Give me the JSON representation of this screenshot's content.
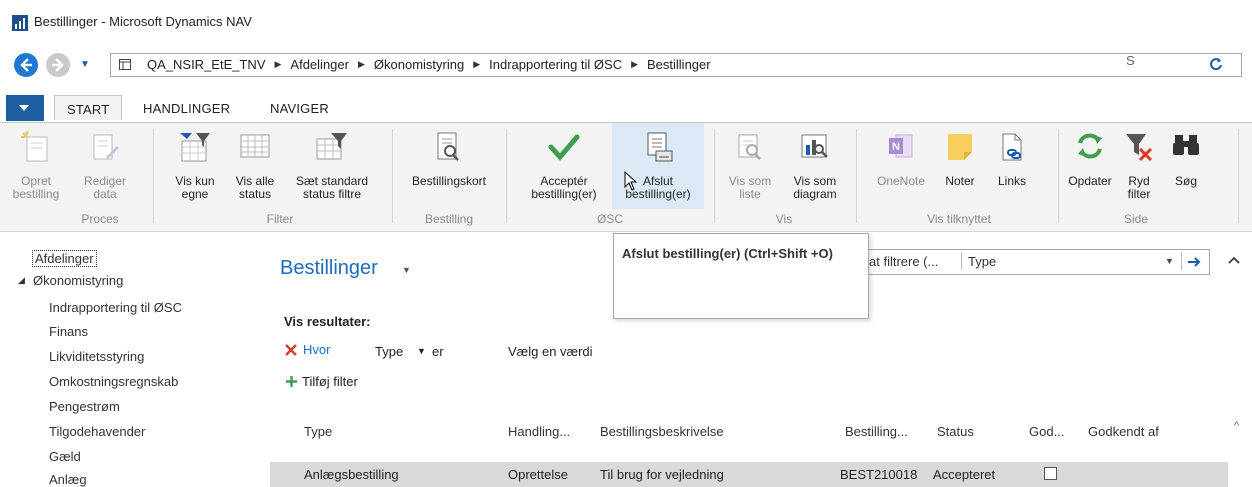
{
  "window": {
    "title": "Bestillinger - Microsoft Dynamics NAV"
  },
  "address": {
    "crumbs": [
      "QA_NSIR_EtE_TNV",
      "Afdelinger",
      "Økonomistyring",
      "Indrapportering til ØSC",
      "Bestillinger"
    ],
    "search_partial": "S"
  },
  "tabs": {
    "start": "START",
    "handlinger": "HANDLINGER",
    "naviger": "NAVIGER"
  },
  "ribbon": {
    "buttons": [
      {
        "l1": "Opret",
        "l2": "bestilling",
        "icon": "new-document-icon"
      },
      {
        "l1": "Rediger",
        "l2": "data",
        "icon": "edit-document-icon"
      },
      {
        "l1": "Vis kun",
        "l2": "egne",
        "icon": "filter-own-icon"
      },
      {
        "l1": "Vis alle",
        "l2": "status",
        "icon": "grid-all-icon"
      },
      {
        "l1": "Sæt standard",
        "l2": "status filtre",
        "icon": "grid-filter-icon"
      },
      {
        "l1": "Bestillingskort",
        "l2": "",
        "icon": "card-view-icon"
      },
      {
        "l1": "Acceptér",
        "l2": "bestilling(er)",
        "icon": "checkmark-icon"
      },
      {
        "l1": "Afslut",
        "l2": "bestilling(er)",
        "icon": "document-printer-icon"
      },
      {
        "l1": "Vis som",
        "l2": "liste",
        "icon": "list-view-icon"
      },
      {
        "l1": "Vis som",
        "l2": "diagram",
        "icon": "chart-view-icon"
      },
      {
        "l1": "OneNote",
        "l2": "",
        "icon": "onenote-icon"
      },
      {
        "l1": "Noter",
        "l2": "",
        "icon": "note-icon"
      },
      {
        "l1": "Links",
        "l2": "",
        "icon": "link-icon"
      },
      {
        "l1": "Opdater",
        "l2": "",
        "icon": "refresh-icon"
      },
      {
        "l1": "Ryd",
        "l2": "filter",
        "icon": "clear-filter-icon"
      },
      {
        "l1": "Søg",
        "l2": "",
        "icon": "binoculars-icon"
      }
    ],
    "groups": [
      "Proces",
      "Filter",
      "Bestilling",
      "ØSC",
      "Vis",
      "Vis tilknyttet",
      "Side"
    ]
  },
  "tooltip": {
    "text": "Afslut bestilling(er) (Ctrl+Shift +O)"
  },
  "nav": {
    "items": [
      "Afdelinger",
      "Økonomistyring",
      "Indrapportering til ØSC",
      "Finans",
      "Likviditetsstyring",
      "Omkostningsregnskab",
      "Pengestrøm",
      "Tilgodehavender",
      "Gæld",
      "Anlæg"
    ]
  },
  "content": {
    "title": "Bestillinger",
    "filter_placeholder": "at filtrere (...",
    "filter_field": "Type",
    "show_results": "Vis resultater:",
    "filter_where": "Hvor",
    "filter_type": "Type",
    "filter_op": "er",
    "filter_value": "Vælg en værdi",
    "add_filter": "Tilføj filter",
    "columns": [
      "Type",
      "Handling...",
      "Bestillingsbeskrivelse",
      "Bestilling...",
      "Status",
      "God...",
      "Godkendt af"
    ],
    "rows": [
      {
        "type": "Anlægsbestilling",
        "handling": "Oprettelse",
        "beskrivelse": "Til brug for vejledning",
        "nr": "BEST210018",
        "status": "Accepteret"
      }
    ]
  },
  "colors": {
    "accent": "#1c6cbf",
    "ribbon_bg": "#f3f3f3",
    "selected_row": "#d9d9d9",
    "tab_menu": "#1e5ea0"
  }
}
